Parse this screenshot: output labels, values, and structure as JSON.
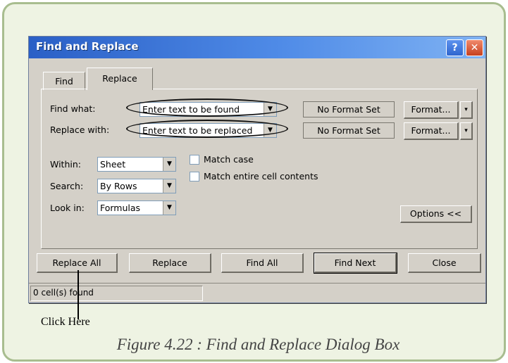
{
  "window": {
    "title": "Find and Replace",
    "help_glyph": "?",
    "close_glyph": "✕",
    "colors": {
      "titlebar_start": "#2a5fc6",
      "titlebar_end": "#7fb2f3",
      "face": "#d4d0c8",
      "close": "#c6401e",
      "panel_bg": "#eef3e3",
      "panel_border": "#a8bd8f"
    }
  },
  "tabs": [
    {
      "label": "Find",
      "active": false
    },
    {
      "label": "Replace",
      "active": true
    }
  ],
  "find_row": {
    "label": "Find what:",
    "value": "Enter text to be found",
    "format_status": "No Format Set",
    "format_button": "Format...",
    "menu_glyph": "▾"
  },
  "replace_row": {
    "label": "Replace with:",
    "value": "Enter text to be replaced",
    "format_status": "No Format Set",
    "format_button": "Format...",
    "menu_glyph": "▾"
  },
  "options": {
    "within": {
      "label": "Within:",
      "value": "Sheet"
    },
    "search": {
      "label": "Search:",
      "value": "By Rows"
    },
    "look_in": {
      "label": "Look in:",
      "value": "Formulas"
    },
    "match_case": {
      "label": "Match case",
      "checked": false
    },
    "match_entire": {
      "label": "Match entire cell contents",
      "checked": false
    },
    "options_button": "Options <<",
    "dropdown_glyph": "▼"
  },
  "buttons": {
    "replace_all": "Replace All",
    "replace": "Replace",
    "find_all": "Find All",
    "find_next": "Find Next",
    "close": "Close"
  },
  "status": "0 cell(s) found",
  "annotation": {
    "callout": "Click Here",
    "caption": "Figure 4.22 : Find and Replace Dialog Box"
  }
}
